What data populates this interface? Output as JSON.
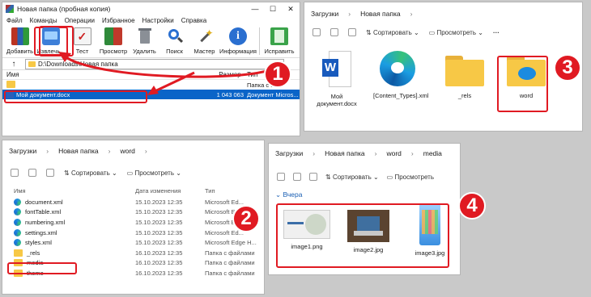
{
  "winrar": {
    "title": "Новая папка (пробная копия)",
    "menu": [
      "Файл",
      "Команды",
      "Операции",
      "Избранное",
      "Настройки",
      "Справка"
    ],
    "toolbar": [
      "Добавить",
      "Извлечь...",
      "Тест",
      "Просмотр",
      "Удалить",
      "Поиск",
      "Мастер",
      "Информация",
      "Исправить"
    ],
    "path": "D:\\Downloads\\Новая папка",
    "columns": {
      "name": "Имя",
      "size": "Размер",
      "type": "Тип"
    },
    "up_row_type": "Папка с ...",
    "file": {
      "name": "Мой документ.docx",
      "size": "1 043 063",
      "type": "Документ Micros..."
    }
  },
  "explorer1": {
    "breadcrumb": [
      "Загрузки",
      "Новая папка"
    ],
    "sort": "Сортировать",
    "view": "Просмотреть",
    "items": [
      "Мой документ.docx",
      "[Content_Types].xml",
      "_rels",
      "word"
    ]
  },
  "explorer2": {
    "breadcrumb": [
      "Загрузки",
      "Новая папка",
      "word"
    ],
    "sort": "Сортировать",
    "view": "Просмотреть",
    "columns": {
      "name": "Имя",
      "date": "Дата изменения",
      "type": "Тип"
    },
    "rows": [
      {
        "name": "document.xml",
        "date": "15.10.2023 12:35",
        "type": "Microsoft Ed..."
      },
      {
        "name": "fontTable.xml",
        "date": "15.10.2023 12:35",
        "type": "Microsoft Ed..."
      },
      {
        "name": "numbering.xml",
        "date": "15.10.2023 12:35",
        "type": "Microsoft Ed..."
      },
      {
        "name": "settings.xml",
        "date": "15.10.2023 12:35",
        "type": "Microsoft Ed..."
      },
      {
        "name": "styles.xml",
        "date": "15.10.2023 12:35",
        "type": "Microsoft Edge H..."
      },
      {
        "name": "_rels",
        "date": "16.10.2023 12:35",
        "type": "Папка с файлами"
      },
      {
        "name": "media",
        "date": "16.10.2023 12:35",
        "type": "Папка с файлами"
      },
      {
        "name": "theme",
        "date": "16.10.2023 12:35",
        "type": "Папка с файлами"
      }
    ]
  },
  "explorer3": {
    "breadcrumb": [
      "Загрузки",
      "Новая папка",
      "word",
      "media"
    ],
    "sort": "Сортировать",
    "view": "Просмотреть",
    "group": "Вчера",
    "images": [
      "image1.png",
      "image2.jpg",
      "image3.jpg"
    ]
  },
  "badges": [
    "1",
    "2",
    "3",
    "4"
  ],
  "colors": {
    "accent_red": "#e01a22",
    "selection_blue": "#0a64c8",
    "folder_yellow": "#f7c846"
  }
}
